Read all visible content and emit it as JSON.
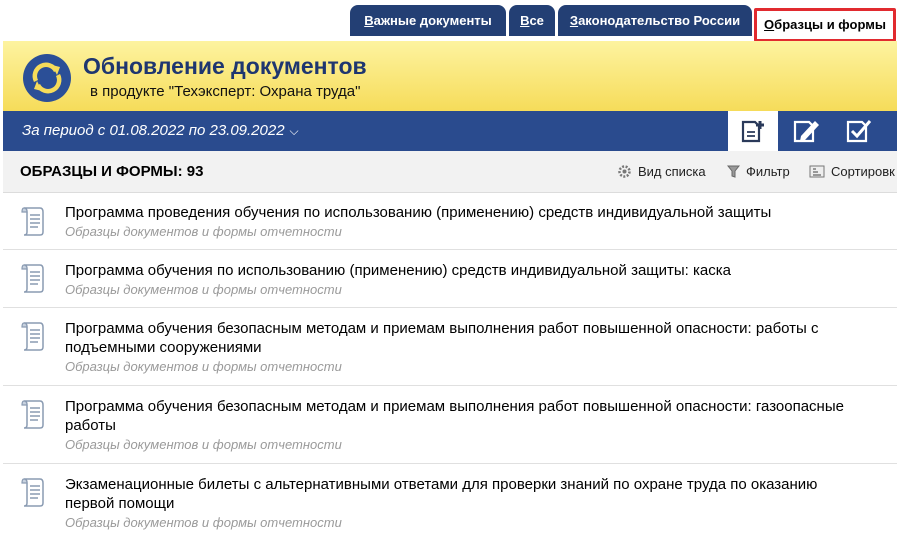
{
  "tabs": [
    {
      "label": "Важные документы",
      "underline": "В",
      "rest": "ажные документы"
    },
    {
      "label": "Все",
      "underline": "В",
      "rest": "се"
    },
    {
      "label": "Законодательство России",
      "underline": "З",
      "rest": "аконодательство России"
    },
    {
      "label": "Образцы и формы",
      "underline": "О",
      "rest": "бразцы и формы"
    }
  ],
  "header": {
    "title": "Обновление документов",
    "subtitle": "в продукте \"Техэксперт: Охрана труда\""
  },
  "period": {
    "label": "За период с 01.08.2022 по 23.09.2022"
  },
  "section": {
    "count_label": "ОБРАЗЦЫ И ФОРМЫ: 93",
    "view_label": "Вид списка",
    "filter_label": "Фильтр",
    "sort_label": "Сортировк"
  },
  "items": [
    {
      "title": "Программа проведения обучения по использованию (применению) средств индивидуальной защиты",
      "category": "Образцы документов и формы отчетности"
    },
    {
      "title": "Программа обучения по использованию (применению) средств индивидуальной защиты: каска",
      "category": "Образцы документов и формы отчетности"
    },
    {
      "title": "Программа обучения безопасным методам и приемам выполнения работ повышенной опасности: работы с подъемными сооружениями",
      "category": "Образцы документов и формы отчетности"
    },
    {
      "title": "Программа обучения безопасным методам и приемам выполнения работ повышенной опасности: газоопасные работы",
      "category": "Образцы документов и формы отчетности"
    },
    {
      "title": "Экзаменационные билеты с альтернативными ответами для проверки знаний по охране труда по оказанию первой помощи",
      "category": "Образцы документов и формы отчетности"
    }
  ],
  "colors": {
    "navy": "#233f74",
    "bar": "#2a4b8e",
    "header_yellow": "#f6dc5a",
    "active_border": "#e12a2f",
    "category_gray": "#9a9a9a"
  },
  "icons": {
    "logo": "refresh-icon",
    "tool1": "add-document-icon",
    "tool2": "edit-document-icon",
    "tool3": "check-document-icon",
    "view": "gear-icon",
    "filter": "funnel-icon",
    "sort": "sort-icon",
    "item": "document-scroll-icon"
  }
}
